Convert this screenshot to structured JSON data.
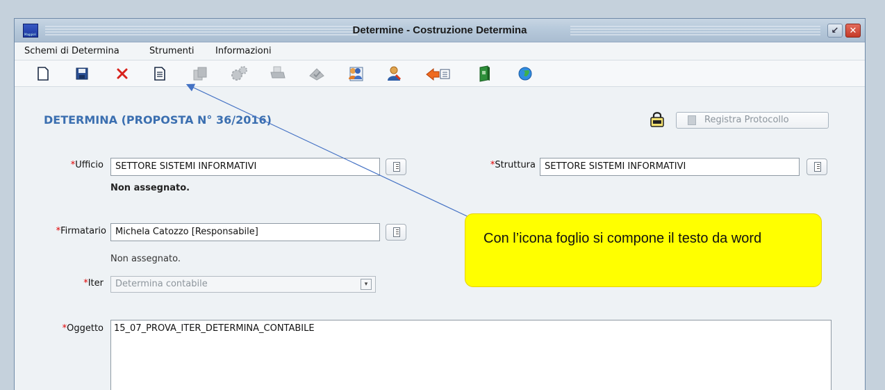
{
  "window": {
    "title": "Determine - Costruzione Determina",
    "app_icon_text": "Maggioli"
  },
  "menu": [
    "Schemi di Determina",
    "Strumenti",
    "Informazioni"
  ],
  "toolbar": {
    "icons": [
      "new-document-icon",
      "save-icon",
      "delete-icon",
      "compose-text-icon",
      "copy-icon",
      "settings-icon",
      "print-icon",
      "sign-icon",
      "users-icon",
      "user-icon",
      "export-icon",
      "book-icon",
      "globe-icon"
    ]
  },
  "header": {
    "title": "DETERMINA (PROPOSTA N° 36/2016)",
    "register_button": "Registra Protocollo"
  },
  "form": {
    "required_mark": "*",
    "ufficio_label": "Ufficio",
    "ufficio_value": "SETTORE SISTEMI INFORMATIVI",
    "ufficio_note": "Non assegnato.",
    "struttura_label": "Struttura",
    "struttura_value": "SETTORE SISTEMI INFORMATIVI",
    "firmatario_label": "Firmatario",
    "firmatario_value": "Michela Catozzo [Responsabile]",
    "firmatario_note": "Non assegnato.",
    "iter_label": "Iter",
    "iter_value": "Determina contabile",
    "oggetto_label": "Oggetto",
    "oggetto_value": "15_07_PROVA_ITER_DETERMINA_CONTABILE"
  },
  "callout": {
    "text": "Con l’icona foglio si compone il testo da word"
  }
}
